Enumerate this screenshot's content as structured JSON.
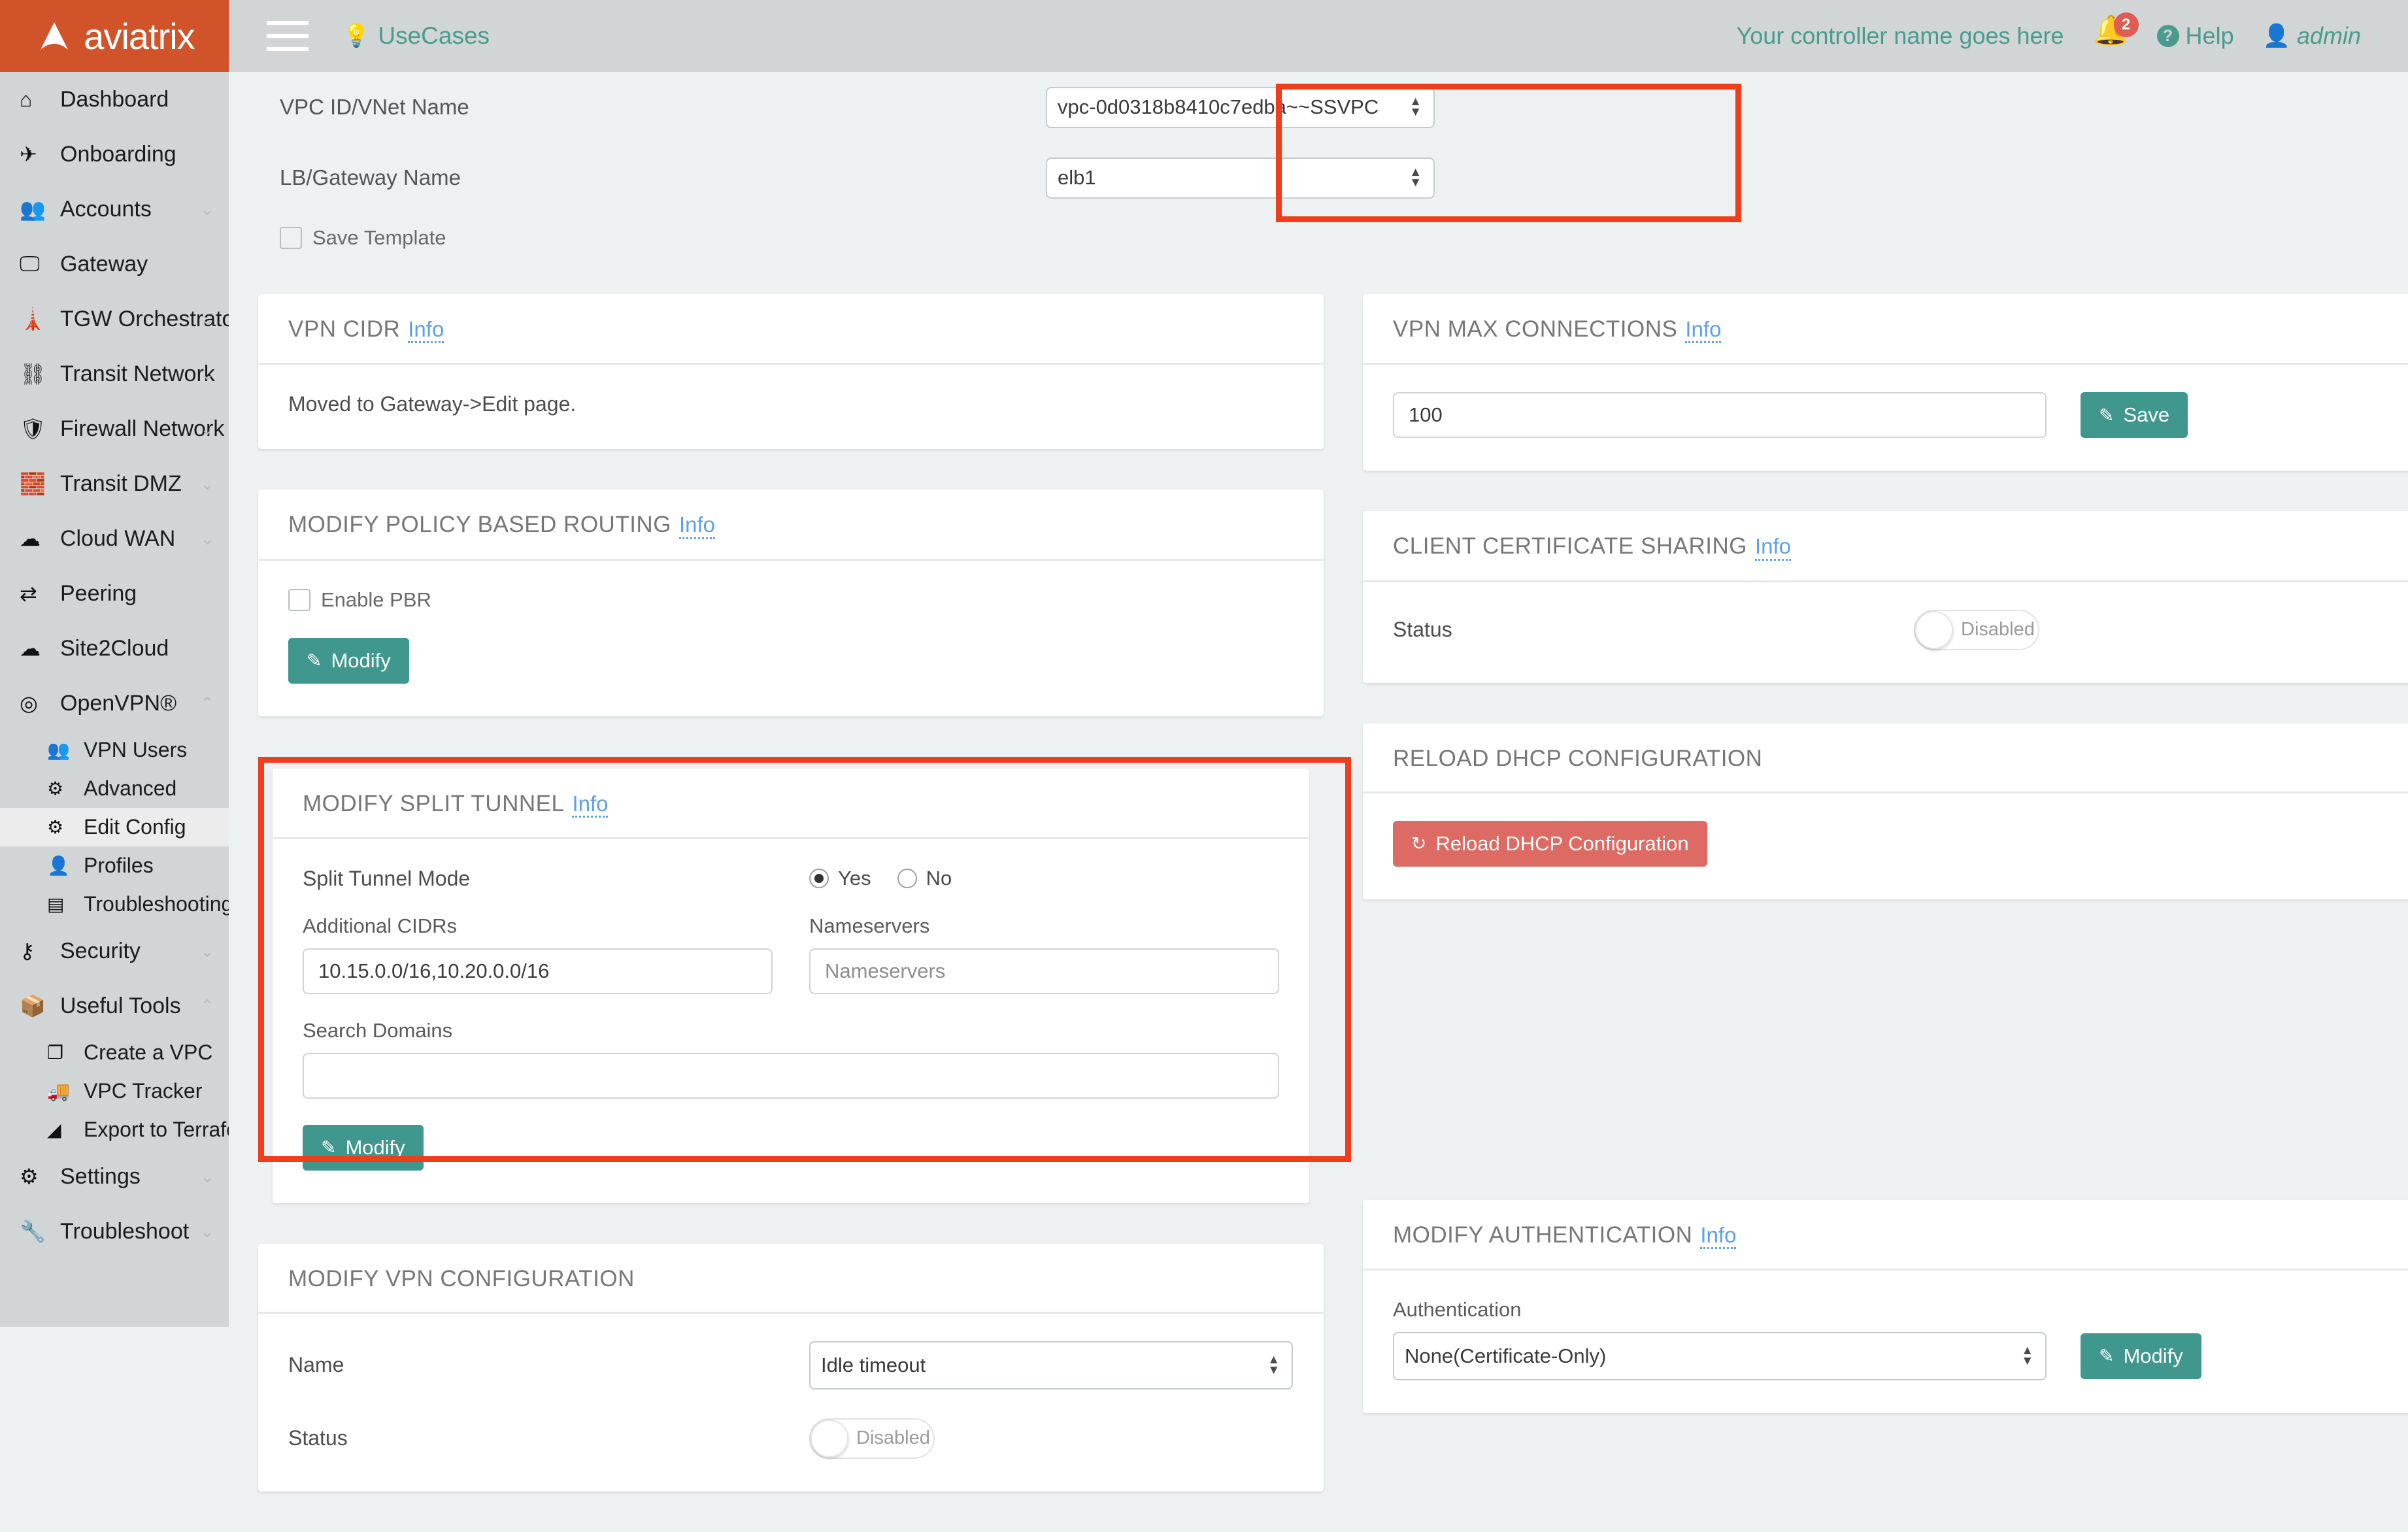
{
  "header": {
    "brand": "aviatrix",
    "menu_icon": "hamburger-icon",
    "usecases_label": "UseCases",
    "usecases_icon": "lightbulb-icon",
    "controller_name": "Your controller name goes here",
    "notification_count": "2",
    "help_label": "Help",
    "admin_label": "admin",
    "brand_color": "#d0532a",
    "accent_color": "#4a9b8e",
    "badge_color": "#e05c52"
  },
  "sidebar": {
    "items": [
      {
        "label": "Dashboard",
        "icon": "home-icon",
        "caret": "",
        "sub": false,
        "active": false
      },
      {
        "label": "Onboarding",
        "icon": "plane-icon",
        "caret": "",
        "sub": false,
        "active": false
      },
      {
        "label": "Accounts",
        "icon": "users-icon",
        "caret": "⌄",
        "sub": false,
        "active": false
      },
      {
        "label": "Gateway",
        "icon": "monitor-icon",
        "caret": "",
        "sub": false,
        "active": false
      },
      {
        "label": "TGW Orchestrator",
        "icon": "control-tower-icon",
        "caret": "⌄",
        "sub": false,
        "active": false
      },
      {
        "label": "Transit Network",
        "icon": "network-icon",
        "caret": "⌄",
        "sub": false,
        "active": false
      },
      {
        "label": "Firewall Network",
        "icon": "shield-icon",
        "caret": "⌄",
        "sub": false,
        "active": false
      },
      {
        "label": "Transit DMZ",
        "icon": "brick-wall-icon",
        "caret": "⌄",
        "sub": false,
        "active": false
      },
      {
        "label": "Cloud WAN",
        "icon": "cloud-icon",
        "caret": "⌄",
        "sub": false,
        "active": false
      },
      {
        "label": "Peering",
        "icon": "shuffle-icon",
        "caret": "",
        "sub": false,
        "active": false
      },
      {
        "label": "Site2Cloud",
        "icon": "cloud-upload-icon",
        "caret": "",
        "sub": false,
        "active": false
      },
      {
        "label": "OpenVPN®",
        "icon": "wifi-icon",
        "caret": "⌃",
        "sub": false,
        "active": false
      },
      {
        "label": "VPN Users",
        "icon": "people-icon",
        "caret": "",
        "sub": true,
        "active": false
      },
      {
        "label": "Advanced",
        "icon": "gears-icon",
        "caret": "",
        "sub": true,
        "active": false
      },
      {
        "label": "Edit Config",
        "icon": "gear-icon",
        "caret": "",
        "sub": true,
        "active": true
      },
      {
        "label": "Profiles",
        "icon": "person-icon",
        "caret": "",
        "sub": true,
        "active": false
      },
      {
        "label": "Troubleshooting",
        "icon": "card-icon",
        "caret": "",
        "sub": true,
        "active": false
      },
      {
        "label": "Security",
        "icon": "key-icon",
        "caret": "⌄",
        "sub": false,
        "active": false
      },
      {
        "label": "Useful Tools",
        "icon": "box-icon",
        "caret": "⌃",
        "sub": false,
        "active": false
      },
      {
        "label": "Create a VPC",
        "icon": "blocks-icon",
        "caret": "",
        "sub": true,
        "active": false
      },
      {
        "label": "VPC Tracker",
        "icon": "truck-icon",
        "caret": "",
        "sub": true,
        "active": false
      },
      {
        "label": "Export to Terraform",
        "icon": "terraform-icon",
        "caret": "",
        "sub": true,
        "active": false
      },
      {
        "label": "Settings",
        "icon": "gear-icon",
        "caret": "⌄",
        "sub": false,
        "active": false
      },
      {
        "label": "Troubleshoot",
        "icon": "wrench-icon",
        "caret": "⌄",
        "sub": false,
        "active": false
      }
    ]
  },
  "topform": {
    "vpc_label": "VPC ID/VNet Name",
    "vpc_value": "vpc-0d0318b8410c7edba~~SSVPC",
    "lb_label": "LB/Gateway Name",
    "lb_value": "elb1",
    "save_template_label": "Save Template",
    "highlight_color": "#ef3e1c"
  },
  "panels": {
    "vpn_cidr": {
      "title": "VPN CIDR",
      "info": "Info",
      "body_text": "Moved to Gateway->Edit page."
    },
    "vpn_max_connections": {
      "title": "VPN MAX CONNECTIONS",
      "info": "Info",
      "value": "100",
      "save_label": "Save",
      "save_icon": "edit-square-icon"
    },
    "modify_pbr": {
      "title": "MODIFY POLICY BASED ROUTING",
      "info": "Info",
      "checkbox_label": "Enable PBR",
      "modify_label": "Modify",
      "modify_icon": "edit-square-icon"
    },
    "client_cert_sharing": {
      "title": "CLIENT CERTIFICATE SHARING",
      "info": "Info",
      "status_label": "Status",
      "toggle_text": "Disabled"
    },
    "modify_split_tunnel": {
      "title": "MODIFY SPLIT TUNNEL",
      "info": "Info",
      "mode_label": "Split Tunnel Mode",
      "radio_yes": "Yes",
      "radio_no": "No",
      "additional_cidrs_label": "Additional CIDRs",
      "additional_cidrs_value": "10.15.0.0/16,10.20.0.0/16",
      "nameservers_label": "Nameservers",
      "nameservers_placeholder": "Nameservers",
      "search_domains_label": "Search Domains",
      "search_domains_value": "",
      "modify_label": "Modify",
      "modify_icon": "edit-square-icon"
    },
    "reload_dhcp": {
      "title": "RELOAD DHCP CONFIGURATION",
      "button_label": "Reload DHCP Configuration",
      "button_icon": "refresh-icon"
    },
    "modify_vpn_config": {
      "title": "MODIFY VPN CONFIGURATION",
      "name_label": "Name",
      "name_value": "Idle timeout",
      "status_label": "Status",
      "toggle_text": "Disabled"
    },
    "modify_authentication": {
      "title": "MODIFY AUTHENTICATION",
      "info": "Info",
      "auth_label": "Authentication",
      "auth_value": "None(Certificate-Only)",
      "modify_label": "Modify",
      "modify_icon": "edit-square-icon"
    }
  }
}
